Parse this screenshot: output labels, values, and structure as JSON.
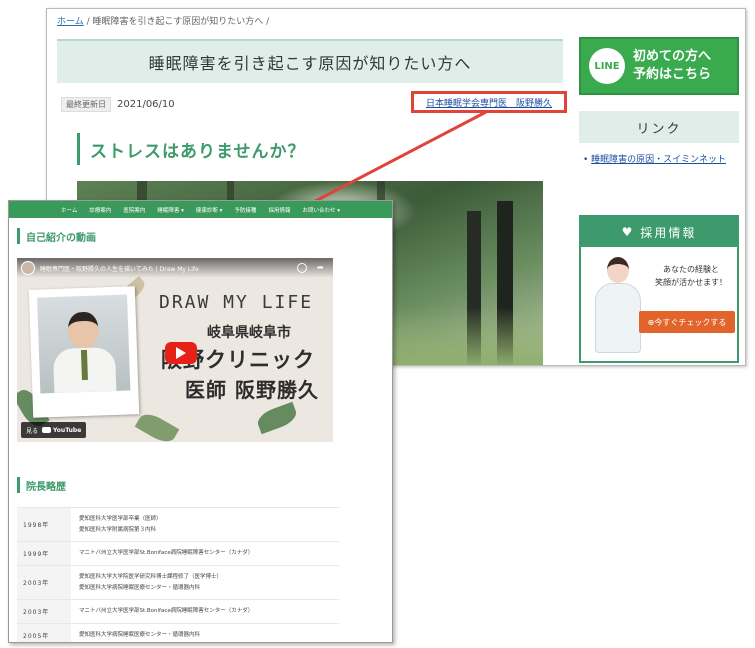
{
  "back_page": {
    "breadcrumb_home": "ホーム",
    "breadcrumb_rest": " / 睡眠障害を引き起こす原因が知りたい方へ /",
    "title": "睡眠障害を引き起こす原因が知りたい方へ",
    "updated_label": "最終更新日",
    "updated_date": "2021/06/10",
    "author_link": "日本睡眠学会専門医　阪野勝久",
    "section_heading": "ストレスはありませんか？",
    "sidebar": {
      "line_logo": "LINE",
      "line_line1": "初めての方へ",
      "line_line2": "予約はこちら",
      "links_heading": "リンク",
      "link_item": "睡眠障害の原因・スイミンネット",
      "recruit_heading": "採用情報",
      "recruit_copy_1": "あなたの経験と",
      "recruit_copy_2": "笑顔が活かせます！",
      "recruit_button": "⊕今すぐチェックする"
    }
  },
  "front_page": {
    "nav": [
      "ホーム",
      "診療案内",
      "医院案内",
      "睡眠障害 ▾",
      "健康診断 ▾",
      "予防接種",
      "採用情報",
      "お問い合わせ ▾"
    ],
    "intro_heading": "自己紹介の動画",
    "video": {
      "title": "睡眠専門医・阪野勝久の人生を描いてみた | Draw My Life",
      "draw_text": "DRAW MY LIFE",
      "place": "岐阜県岐阜市",
      "clinic": "阪野クリニック",
      "doctor": "医師 阪野勝久",
      "watch_on": "見る",
      "youtube": "YouTube"
    },
    "history_heading": "院長略歴",
    "history": [
      {
        "year": "1998年",
        "lines": [
          "愛知医科大学医学部卒業（医師）",
          "愛知医科大学附属病院第３内科"
        ]
      },
      {
        "year": "1999年",
        "lines": [
          "マニトバ州立大学医学部St.Boniface病院睡眠障害センター（カナダ）"
        ]
      },
      {
        "year": "2003年",
        "lines": [
          "愛知医科大学大学院医学研究科博士課程修了（医学博士）",
          "愛知医科大学病院睡眠医療センター・循環器内科"
        ]
      },
      {
        "year": "2003年",
        "lines": [
          "マニトバ州立大学医学部St.Boniface病院睡眠障害センター（カナダ）"
        ]
      },
      {
        "year": "2005年",
        "lines": [
          "愛知医科大学病院睡眠医療センター・循環器内科"
        ]
      }
    ]
  },
  "colors": {
    "accent_green": "#3c9a6c",
    "line_green": "#3aaa4f",
    "highlight_red": "#e0433a",
    "button_orange": "#e2642b"
  }
}
